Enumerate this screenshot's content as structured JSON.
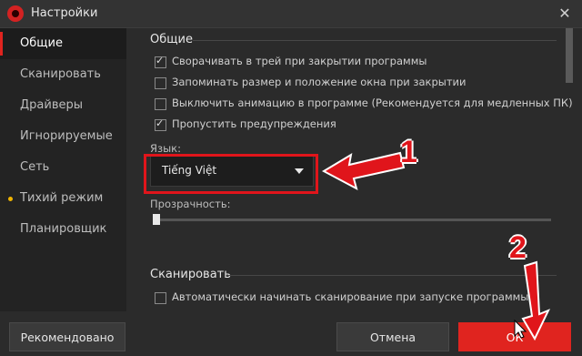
{
  "window": {
    "title": "Настройки",
    "close_glyph": "✕"
  },
  "sidebar": {
    "items": [
      {
        "label": "Общие",
        "active": true
      },
      {
        "label": "Сканировать"
      },
      {
        "label": "Драйверы"
      },
      {
        "label": "Игнорируемые"
      },
      {
        "label": "Сеть"
      },
      {
        "label": "Тихий режим",
        "indicator": "yellow-dot"
      },
      {
        "label": "Планировщик"
      }
    ]
  },
  "general": {
    "title": "Общие",
    "options": [
      {
        "label": "Сворачивать в трей при закрытии программы",
        "checked": true
      },
      {
        "label": "Запоминать размер и положение окна при закрытии",
        "checked": false
      },
      {
        "label": "Выключить анимацию в программе (Рекомендуется для медленных ПК)",
        "checked": false
      },
      {
        "label": "Пропустить предупреждения",
        "checked": true
      }
    ],
    "language_label": "Язык:",
    "language_value": "Tiếng Việt",
    "transparency_label": "Прозрачность:",
    "transparency_value": 0
  },
  "scan": {
    "title": "Сканировать",
    "options": [
      {
        "label": "Автоматически начинать сканирование при запуске программы",
        "checked": false
      }
    ]
  },
  "footer": {
    "recommended_label": "Рекомендовано",
    "cancel_label": "Отмена",
    "ok_label": "ОК"
  },
  "annotations": {
    "step1": "1",
    "step2": "2"
  },
  "colors": {
    "accent": "#e0241f",
    "annotation_red": "#e0151b",
    "background": "#2b2b2b"
  }
}
